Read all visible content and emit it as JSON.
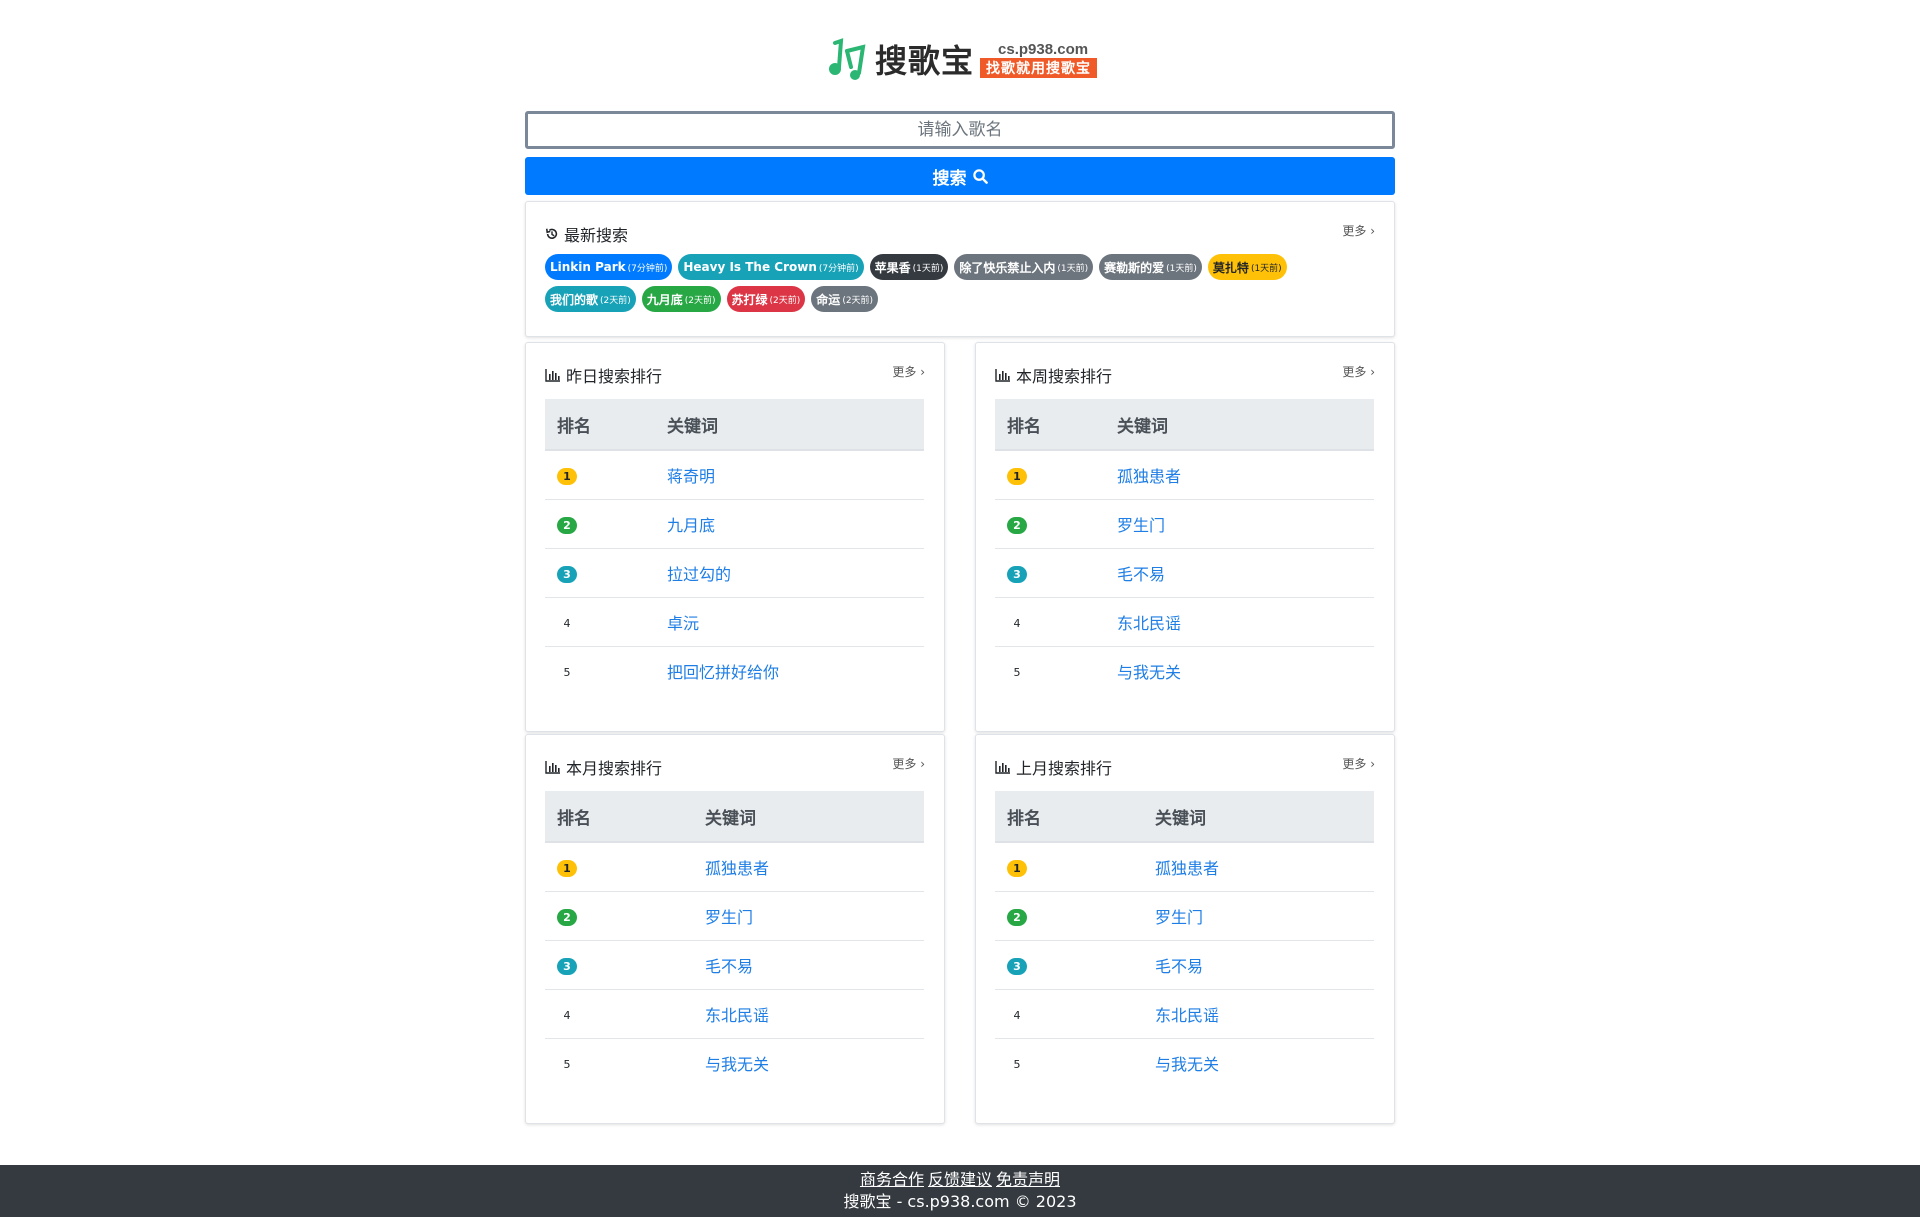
{
  "logo": {
    "name": "搜歌宝",
    "domain": "cs.p938.com",
    "slogan": "找歌就用搜歌宝"
  },
  "search": {
    "placeholder": "请输入歌名",
    "button_label": "搜索"
  },
  "recent": {
    "title": "最新搜索",
    "more": "更多 ›",
    "tags": [
      {
        "name": "Linkin Park",
        "time": "(7分钟前)",
        "color": "#007bff"
      },
      {
        "name": "Heavy Is The Crown",
        "time": "(7分钟前)",
        "color": "#17a2b8"
      },
      {
        "name": "苹果香",
        "time": "(1天前)",
        "color": "#343a40"
      },
      {
        "name": "除了快乐禁止入内",
        "time": "(1天前)",
        "color": "#6c757d"
      },
      {
        "name": "赛勒斯的爱",
        "time": "(1天前)",
        "color": "#6c757d"
      },
      {
        "name": "莫扎特",
        "time": "(1天前)",
        "color": "#ffc107"
      },
      {
        "name": "我们的歌",
        "time": "(2天前)",
        "color": "#17a2b8"
      },
      {
        "name": "九月底",
        "time": "(2天前)",
        "color": "#28a745"
      },
      {
        "name": "苏打绿",
        "time": "(2天前)",
        "color": "#dc3545"
      },
      {
        "name": "命运",
        "time": "(2天前)",
        "color": "#6c757d"
      }
    ]
  },
  "col_rank": "排名",
  "col_keyword": "关键词",
  "rank_colors": [
    "#ffc107",
    "#28a745",
    "#17a2b8"
  ],
  "rankings": [
    {
      "title": "昨日搜索排行",
      "more": "更多 ›",
      "keywords": [
        "蒋奇明",
        "九月底",
        "拉过勾的",
        "卓沅",
        "把回忆拼好给你"
      ]
    },
    {
      "title": "本周搜索排行",
      "more": "更多 ›",
      "keywords": [
        "孤独患者",
        "罗生门",
        "毛不易",
        "东北民谣",
        "与我无关"
      ]
    },
    {
      "title": "本月搜索排行",
      "more": "更多 ›",
      "keywords": [
        "孤独患者",
        "罗生门",
        "毛不易",
        "东北民谣",
        "与我无关"
      ]
    },
    {
      "title": "上月搜索排行",
      "more": "更多 ›",
      "keywords": [
        "孤独患者",
        "罗生门",
        "毛不易",
        "东北民谣",
        "与我无关"
      ]
    }
  ],
  "footer": {
    "links": [
      "商务合作",
      "反馈建议",
      "免责声明"
    ],
    "copyright": "搜歌宝 - cs.p938.com © 2023"
  }
}
